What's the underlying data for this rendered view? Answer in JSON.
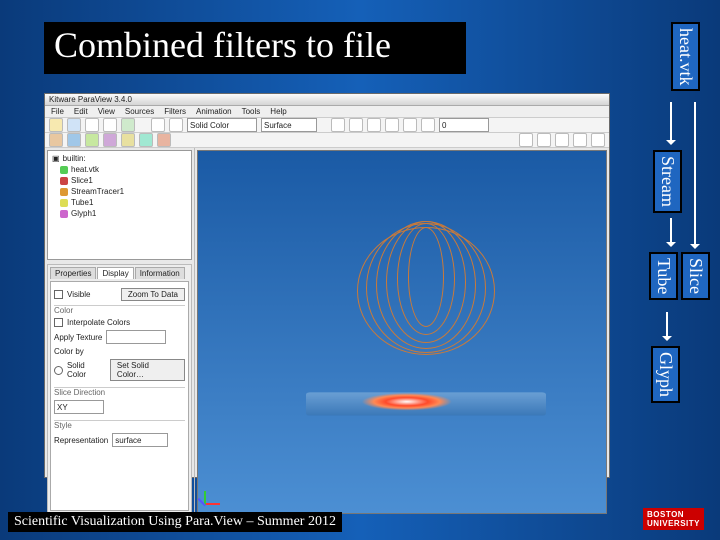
{
  "slide": {
    "title": "Combined filters to file",
    "footer": "Scientific Visualization Using Para.View – Summer 2012",
    "bu_logo_top": "BOSTON",
    "bu_logo_bot": "UNIVERSITY"
  },
  "flow": {
    "root": "heat.vtk",
    "branch1": "Stream",
    "branch1b": "Tube",
    "branch1c": "Glyph",
    "branch2": "Slice"
  },
  "app": {
    "title": "Kitware ParaView 3.4.0",
    "menu": [
      "File",
      "Edit",
      "View",
      "Sources",
      "Filters",
      "Animation",
      "Tools",
      "Help"
    ],
    "solid_color": "Solid Color",
    "representation": "Surface",
    "time": "0",
    "tree_root": "builtin:",
    "tree": [
      {
        "label": "heat.vtk",
        "color": "#55cc55"
      },
      {
        "label": "Slice1",
        "color": "#cc4444"
      },
      {
        "label": "StreamTracer1",
        "color": "#dd9933"
      },
      {
        "label": "Tube1",
        "color": "#dddd55"
      },
      {
        "label": "Glyph1",
        "color": "#cc66cc"
      }
    ],
    "inspector": {
      "tabs": [
        "Properties",
        "Display",
        "Information"
      ],
      "cb_visible": "Visible",
      "btn_zoom": "Zoom To Data",
      "sec_color": "Color",
      "cb_interp": "Interpolate Colors",
      "lbl_apply": "Apply Texture",
      "lbl_colorby": "Color by",
      "r1": "Solid Color",
      "r2": "Set Solid Color…",
      "sec_slice": "Slice Direction",
      "lbl_slice": "XY",
      "sec_style": "Style",
      "lbl_rep": "Representation",
      "val_rep": "surface"
    }
  }
}
